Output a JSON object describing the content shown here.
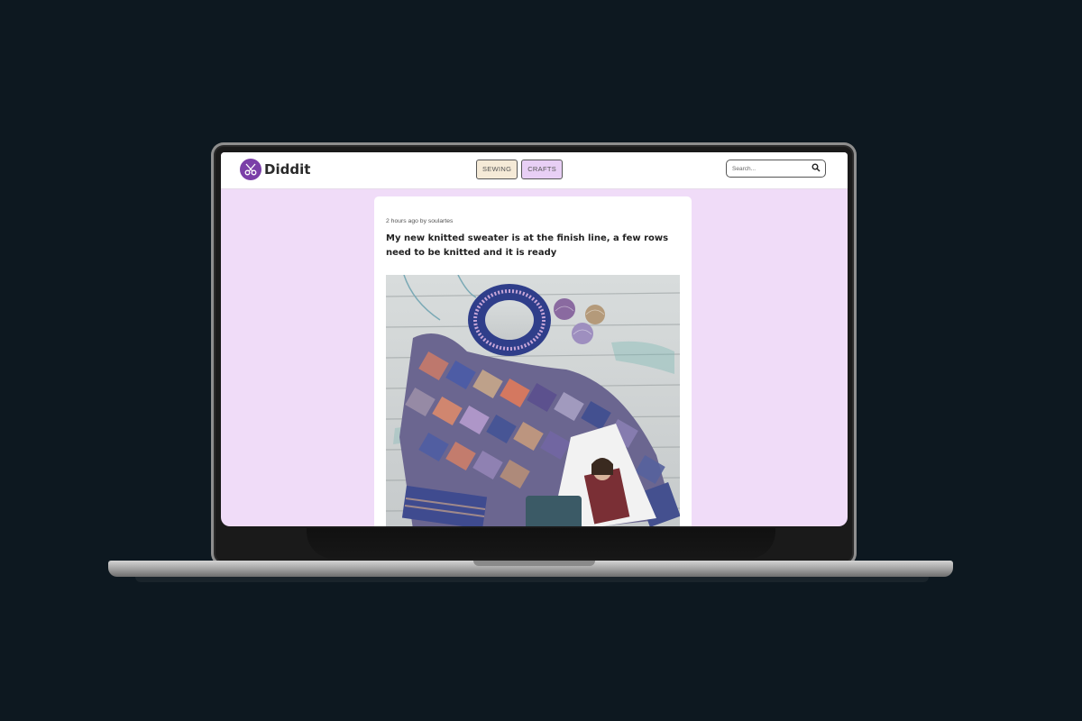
{
  "app": {
    "name": "Diddit"
  },
  "nav": {
    "items": [
      "SEWING",
      "CRAFTS"
    ]
  },
  "search": {
    "placeholder": "Search..."
  },
  "post": {
    "meta": "2 hours ago by soulartes",
    "title": "My new knitted sweater is at the finish line, a few rows need to be knitted and it is ready",
    "image_alt": "knitted sweater"
  },
  "colors": {
    "brand": "#7b3fa8",
    "background": "#f0dcf8",
    "sewing_button": "#f5ead7",
    "crafts_button": "#e8cff5"
  },
  "icons": [
    "scissors-icon",
    "search-icon"
  ]
}
